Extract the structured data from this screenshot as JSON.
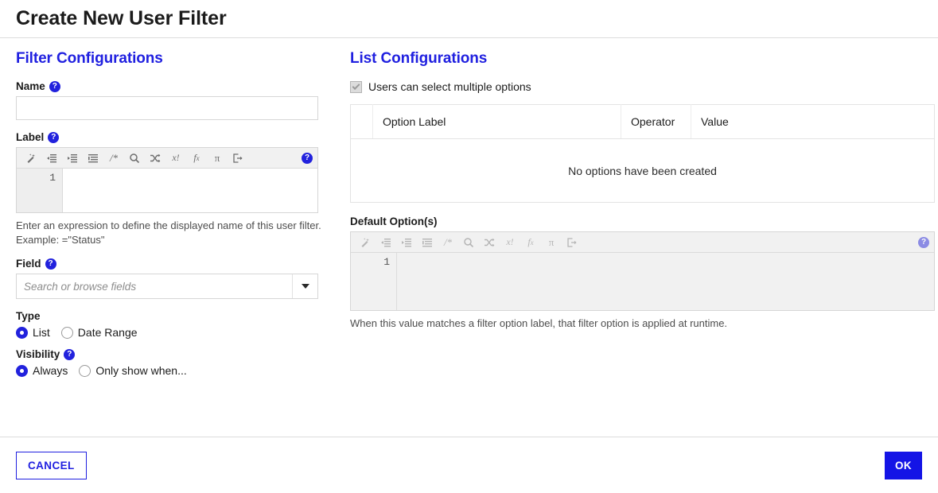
{
  "dialog": {
    "title": "Create New User Filter"
  },
  "filter_config": {
    "section_title": "Filter Configurations",
    "name": {
      "label": "Name",
      "help": "?",
      "value": "",
      "placeholder": ""
    },
    "label_field": {
      "label": "Label",
      "help": "?",
      "line_number": "1",
      "code": "",
      "hint": "Enter an expression to define the displayed name of this user filter. Example: =\"Status\""
    },
    "field": {
      "label": "Field",
      "help": "?",
      "value": "",
      "placeholder": "Search or browse fields"
    },
    "type": {
      "label": "Type",
      "options": [
        {
          "label": "List",
          "checked": true
        },
        {
          "label": "Date Range",
          "checked": false
        }
      ]
    },
    "visibility": {
      "label": "Visibility",
      "help": "?",
      "options": [
        {
          "label": "Always",
          "checked": true
        },
        {
          "label": "Only show when...",
          "checked": false
        }
      ]
    }
  },
  "list_config": {
    "section_title": "List Configurations",
    "multi_select": {
      "label": "Users can select multiple options",
      "checked": true,
      "disabled": true
    },
    "options_table": {
      "columns": [
        "",
        "Option Label",
        "Operator",
        "Value"
      ],
      "rows": [],
      "empty_message": "No options have been created"
    },
    "default_options": {
      "label": "Default Option(s)",
      "help": "?",
      "line_number": "1",
      "code": "",
      "hint": "When this value matches a filter option label, that filter option is applied at runtime."
    }
  },
  "editor_toolbar": {
    "buttons": [
      {
        "name": "magic-wand-icon",
        "glyph": "wand"
      },
      {
        "name": "outdent-icon",
        "glyph": "outdent"
      },
      {
        "name": "indent-icon",
        "glyph": "indent"
      },
      {
        "name": "format-lines-icon",
        "glyph": "lines"
      },
      {
        "name": "comment-icon",
        "glyph": "/*"
      },
      {
        "name": "search-icon",
        "glyph": "search"
      },
      {
        "name": "shuffle-icon",
        "glyph": "shuffle"
      },
      {
        "name": "variable-icon",
        "glyph": "x!"
      },
      {
        "name": "function-icon",
        "glyph": "fx"
      },
      {
        "name": "pi-icon",
        "glyph": "π"
      },
      {
        "name": "export-icon",
        "glyph": "export"
      }
    ]
  },
  "footer": {
    "cancel_label": "CANCEL",
    "ok_label": "OK"
  },
  "colors": {
    "accent": "#2020e0",
    "ok_button": "#1414e6",
    "border": "#dcdcdc",
    "toolbar_bg": "#f1f1f1",
    "gutter_bg": "#eeeeee"
  }
}
